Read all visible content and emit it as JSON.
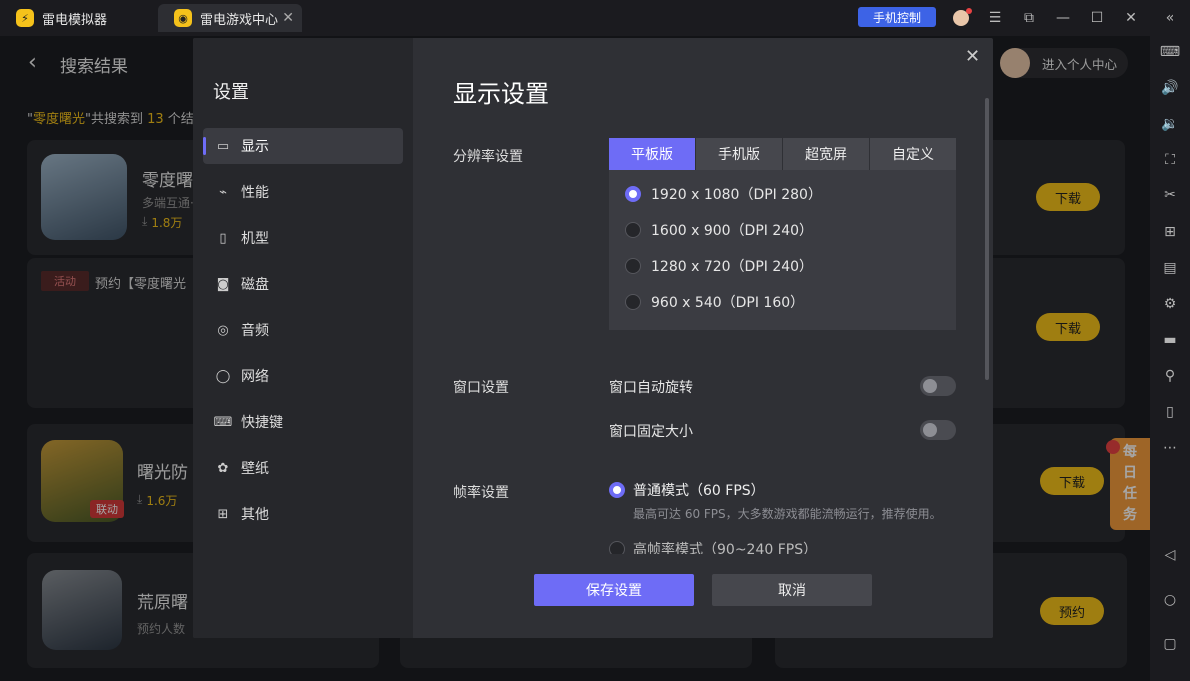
{
  "titlebar": {
    "app_name": "雷电模拟器",
    "tab_label": "雷电游戏中心",
    "tab_close": "✕",
    "phone_control": "手机控制"
  },
  "header": {
    "back_icon": "‹",
    "title": "搜索结果",
    "user_center": "进入个人中心"
  },
  "summary": {
    "prefix": "\"",
    "query": "零度曙光",
    "middle": "\"共搜索到 ",
    "count": "13",
    "suffix": " 个结"
  },
  "games": [
    {
      "name": "零度曙",
      "sub": "多端互通·",
      "downloads": "1.8万",
      "button": "下载"
    },
    {
      "activity_tag": "活动",
      "activity_text": "预约【零度曙光",
      "button": "下载"
    },
    {
      "name": "曙光防",
      "downloads": "1.6万",
      "button": "下载",
      "badge": "联动"
    },
    {
      "name": "荒原曙",
      "sub": "预约人数",
      "button": "预约"
    }
  ],
  "daily_task": "每日任务",
  "settings": {
    "title": "设置",
    "nav": [
      "显示",
      "性能",
      "机型",
      "磁盘",
      "音频",
      "网络",
      "快捷键",
      "壁纸",
      "其他"
    ],
    "heading": "显示设置",
    "resolution_label": "分辨率设置",
    "resolution_tabs": [
      "平板版",
      "手机版",
      "超宽屏",
      "自定义"
    ],
    "resolution_options": [
      "1920 x 1080（DPI 280）",
      "1600 x 900（DPI 240）",
      "1280 x 720（DPI 240）",
      "960 x 540（DPI 160）"
    ],
    "selected_resolution_index": 0,
    "window_label": "窗口设置",
    "auto_rotate": "窗口自动旋转",
    "auto_rotate_on": false,
    "fixed_size": "窗口固定大小",
    "fixed_size_on": false,
    "fps_label": "帧率设置",
    "fps_normal": "普通模式（60 FPS）",
    "fps_normal_desc": "最高可达 60 FPS，大多数游戏都能流畅运行，推荐使用。",
    "fps_high": "高帧率模式（90~240 FPS）",
    "save": "保存设置",
    "cancel": "取消",
    "close": "✕"
  },
  "colors": {
    "accent": "#6e6cf6",
    "brand_yellow": "#f5c21b",
    "phone_control": "#3d63e6"
  }
}
